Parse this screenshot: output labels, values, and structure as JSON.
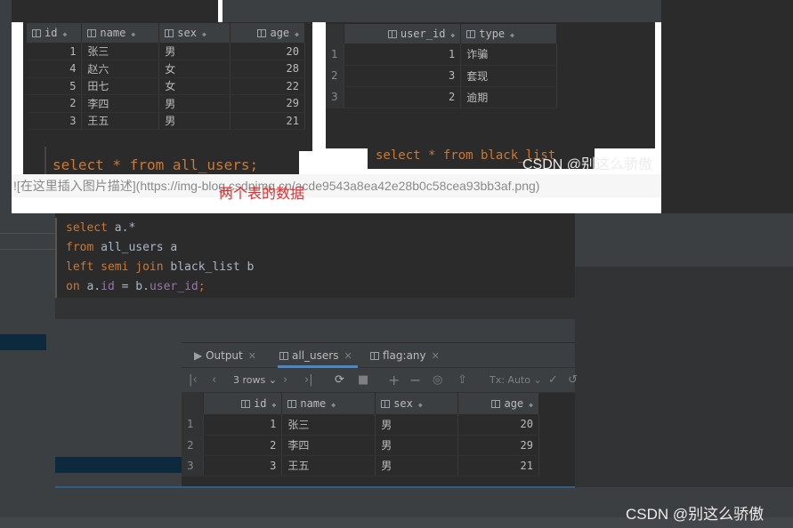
{
  "top_screenshot": {
    "table1": {
      "columns": [
        "id",
        "name",
        "sex",
        "age"
      ],
      "rows": [
        {
          "id": "1",
          "name": "张三",
          "sex": "男",
          "age": "20"
        },
        {
          "id": "4",
          "name": "赵六",
          "sex": "女",
          "age": "28"
        },
        {
          "id": "5",
          "name": "田七",
          "sex": "女",
          "age": "22"
        },
        {
          "id": "2",
          "name": "李四",
          "sex": "男",
          "age": "29"
        },
        {
          "id": "3",
          "name": "王五",
          "sex": "男",
          "age": "21"
        }
      ]
    },
    "table2": {
      "columns": [
        "user_id",
        "type"
      ],
      "rows": [
        {
          "rownum": "1",
          "user_id": "1",
          "type": "诈骗"
        },
        {
          "rownum": "2",
          "user_id": "3",
          "type": "套现"
        },
        {
          "rownum": "3",
          "user_id": "2",
          "type": "逾期"
        }
      ]
    },
    "query1": "select * from all_users;",
    "query2": "select * from black_list",
    "link_text": "![在这里插入图片描述](https://img-blog.csdnimg.cn/acde9543a8ea42e28b0c58cea93bb3af.png)",
    "caption": "两个表的数据",
    "watermark": "CSDN @别这么骄傲"
  },
  "editor": {
    "lines": [
      {
        "kw": "select",
        "rest": " a.*"
      },
      {
        "kw": "from",
        "rest": " all_users a"
      },
      {
        "kw": "left semi join",
        "rest": " black_list b"
      },
      {
        "kw": "on",
        "rest_pre": " a.",
        "field1": "id",
        "mid": " = b.",
        "field2": "user_id",
        "end": ";"
      }
    ]
  },
  "results": {
    "tabs": [
      {
        "label": "Output",
        "icon": "console-icon"
      },
      {
        "label": "all_users",
        "icon": "table-icon",
        "active": true
      },
      {
        "label": "flag:any",
        "icon": "table-icon"
      }
    ],
    "toolbar": {
      "rows_label": "3 rows",
      "tx_label": "Tx: Auto"
    },
    "grid": {
      "columns": [
        "id",
        "name",
        "sex",
        "age"
      ],
      "rows": [
        {
          "rownum": "1",
          "id": "1",
          "name": "张三",
          "sex": "男",
          "age": "20"
        },
        {
          "rownum": "2",
          "id": "2",
          "name": "李四",
          "sex": "男",
          "age": "29"
        },
        {
          "rownum": "3",
          "id": "3",
          "name": "王五",
          "sex": "男",
          "age": "21"
        }
      ]
    }
  },
  "watermark_bottom": "CSDN @别这么骄傲"
}
